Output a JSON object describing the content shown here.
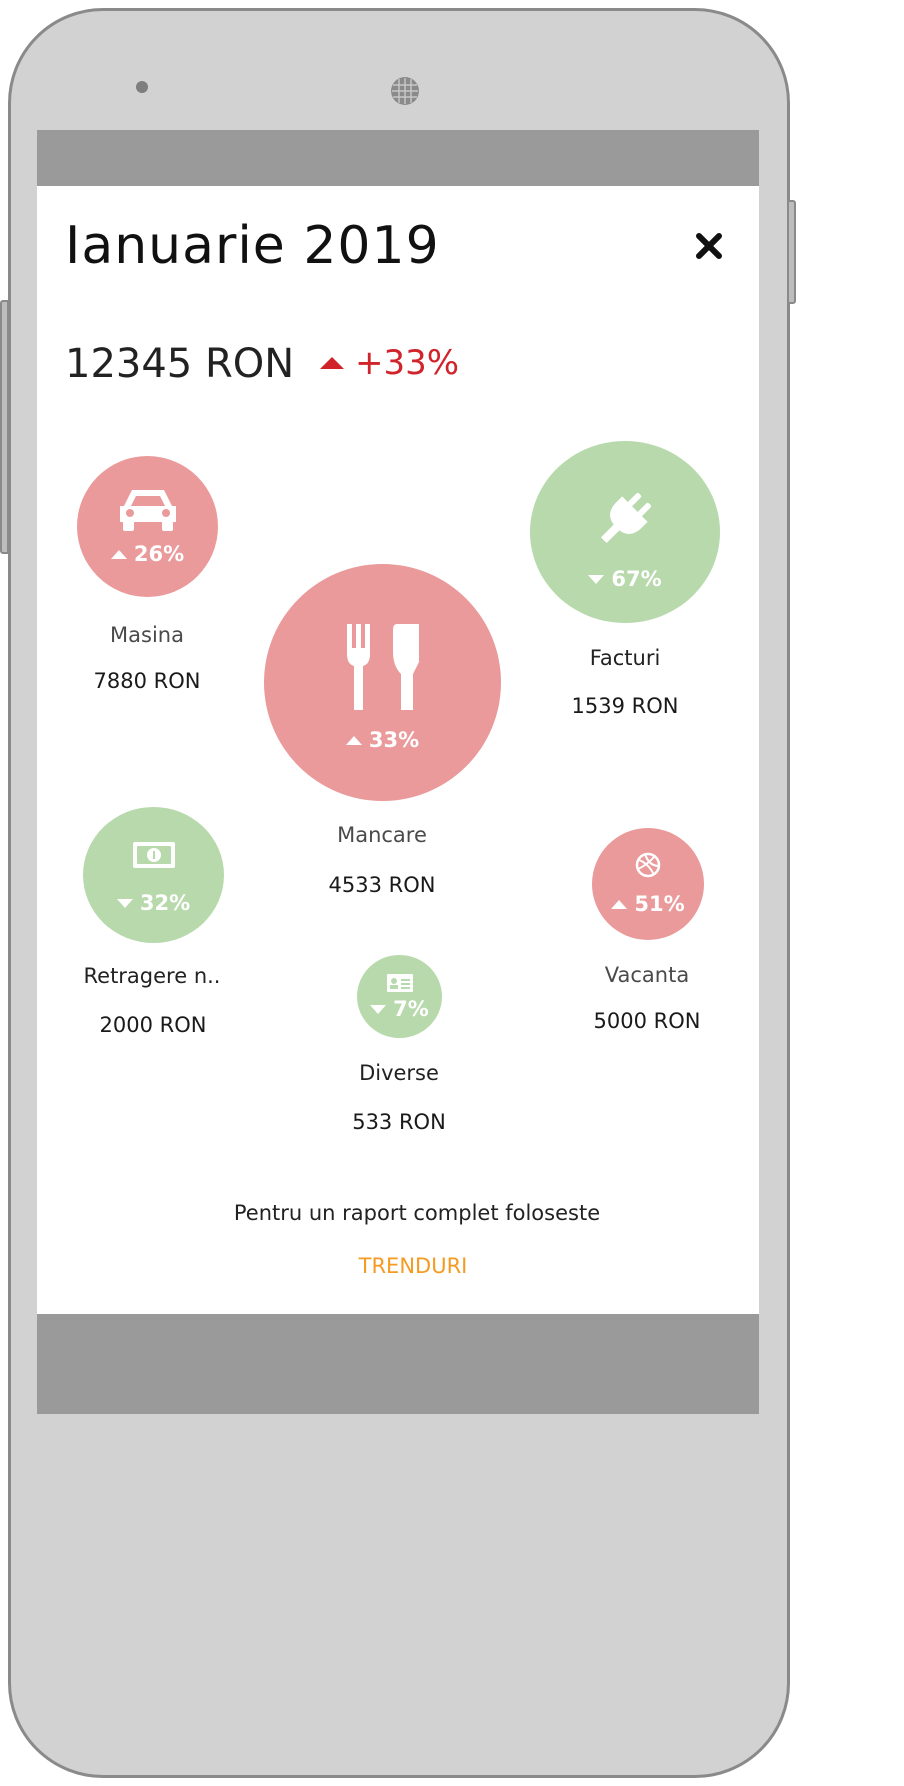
{
  "header": {
    "title": "Ianuarie 2019",
    "close_icon": "close-icon"
  },
  "summary": {
    "total": "12345 RON",
    "change": "+33%",
    "direction": "up"
  },
  "categories": [
    {
      "id": "masina",
      "name": "Masina",
      "amount": "7880 RON",
      "change": "26%",
      "direction": "up",
      "icon": "car-icon",
      "color": "#ea9a9a"
    },
    {
      "id": "mancare",
      "name": "Mancare",
      "amount": "4533 RON",
      "change": "33%",
      "direction": "up",
      "icon": "fork-knife-icon",
      "color": "#ea9a9a"
    },
    {
      "id": "facturi",
      "name": "Facturi",
      "amount": "1539 RON",
      "change": "67%",
      "direction": "down",
      "icon": "plug-icon",
      "color": "#b7d9ab"
    },
    {
      "id": "retragere",
      "name": "Retragere n..",
      "amount": "2000 RON",
      "change": "32%",
      "direction": "down",
      "icon": "money-icon",
      "color": "#b7d9ab"
    },
    {
      "id": "diverse",
      "name": "Diverse",
      "amount": "533 RON",
      "change": "7%",
      "direction": "down",
      "icon": "id-card-icon",
      "color": "#b7d9ab"
    },
    {
      "id": "vacanta",
      "name": "Vacanta",
      "amount": "5000 RON",
      "change": "51%",
      "direction": "up",
      "icon": "ball-icon",
      "color": "#ea9a9a"
    }
  ],
  "footer": {
    "text": "Pentru un raport complet foloseste",
    "link": "TRENDURI"
  },
  "colors": {
    "increase": "#d1232a",
    "link": "#f59a23",
    "bubble_up": "#ea9a9a",
    "bubble_down": "#b7d9ab"
  }
}
